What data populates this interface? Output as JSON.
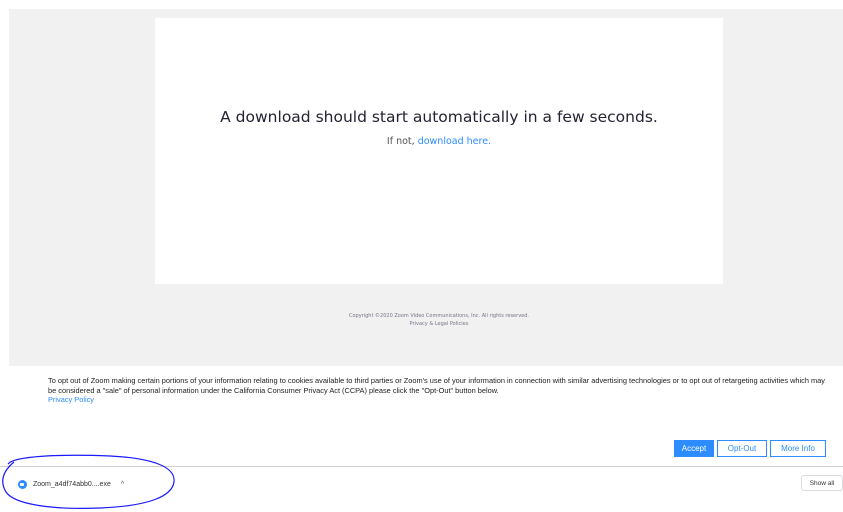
{
  "download_page": {
    "headline": "A download should start automatically in a few seconds.",
    "subline_prefix": "If not, ",
    "download_link": "download here."
  },
  "footer": {
    "copyright": "Copyright ©2020 Zoom Video Communications, Inc. All rights reserved.",
    "privacy_link": "Privacy & Legal Policies"
  },
  "cookie_banner": {
    "text": "To opt out of Zoom making certain portions of your information relating to cookies available to third parties or Zoom's use of your information in connection with similar advertising technologies or to opt out of retargeting activities which may be considered a \"sale\" of personal information under the California Consumer Privacy Act (CCPA) please click the \"Opt-Out\" button below.",
    "policy_link": "Privacy Policy",
    "accept_label": "Accept",
    "optout_label": "Opt-Out",
    "moreinfo_label": "More Info"
  },
  "download_shelf": {
    "filename": "Zoom_a4df74abb0....exe",
    "chevron": "^",
    "show_all_label": "Show all",
    "icon": "zoom-icon"
  },
  "colors": {
    "accent": "#2d8cff",
    "annotation": "#1a1aff"
  }
}
